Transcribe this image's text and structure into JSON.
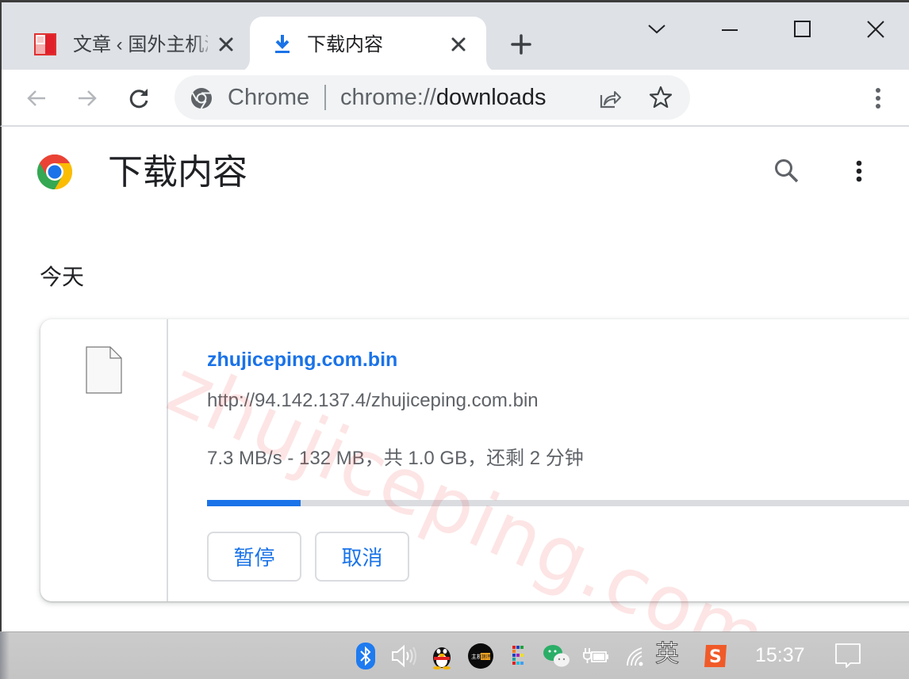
{
  "window": {
    "tabs": [
      {
        "title": "文章 ‹ 国外主机测评",
        "active": false,
        "favicon": "site-seal-icon"
      },
      {
        "title": "下载内容",
        "active": true,
        "favicon": "download-icon"
      }
    ],
    "new_tab_icon": "plus-icon",
    "controls": [
      "tab-search-chevron",
      "minimize",
      "maximize",
      "close"
    ]
  },
  "toolbar": {
    "back_icon": "arrow-left-icon",
    "forward_icon": "arrow-right-icon",
    "reload_icon": "reload-icon",
    "omnibox": {
      "chip": "Chrome",
      "url_scheme": "chrome://",
      "url_host": "downloads"
    },
    "share_icon": "share-icon",
    "bookmark_icon": "star-icon",
    "menu_icon": "more-vert-icon"
  },
  "page": {
    "title": "下载内容",
    "search_icon": "search-icon",
    "more_icon": "more-vert-icon",
    "section": "今天",
    "downloads": [
      {
        "file_name": "zhujiceping.com.bin",
        "url": "http://94.142.137.4/zhujiceping.com.bin",
        "status": "7.3 MB/s - 132 MB，共 1.0 GB，还剩 2 分钟",
        "progress_percent": 13,
        "buttons": {
          "pause": "暂停",
          "cancel": "取消"
        }
      }
    ],
    "watermark": "zhujiceping.com"
  },
  "taskbar": {
    "tray_icons": [
      "bluetooth-icon",
      "volume-icon",
      "qq-icon",
      "zhujiceping-app-icon",
      "colorful-grid-app-icon",
      "wechat-icon",
      "power-plug-battery-icon",
      "wifi-icon"
    ],
    "ime_label": "英",
    "sogou_icon": "sogou-input-icon",
    "clock": "15:37",
    "notification_icon": "action-center-icon"
  },
  "colors": {
    "accent": "#1a73e8",
    "tabstrip": "#dee1e6",
    "omnibox": "#f1f3f4",
    "progress_track": "#dadce0"
  }
}
